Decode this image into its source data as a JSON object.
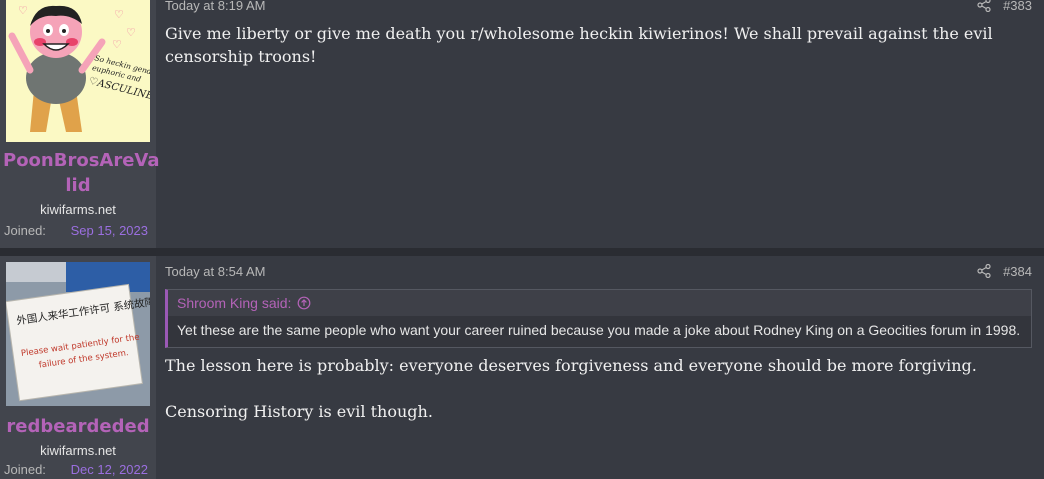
{
  "posts": [
    {
      "username": "PoonBrosAreValid",
      "username_line1": "PoonBrosAreVa",
      "username_line2": "lid",
      "user_title": "kiwifarms.net",
      "joined_label": "Joined:",
      "joined_date": "Sep 15, 2023",
      "avatar_text": "So heckin gender euphoric and MASCULINE",
      "timestamp": "Today at 8:19 AM",
      "post_number": "#383",
      "body": "Give me liberty or give me death you r/wholesome heckin kiwierinos! We shall prevail against the evil censorship troons!"
    },
    {
      "username": "redbeardeded",
      "user_title": "kiwifarms.net",
      "joined_label": "Joined:",
      "joined_date": "Dec 12, 2022",
      "avatar_text_cn": "外国人来华工作许可 系统故障,请耐心等待",
      "avatar_text_en": "Please wait patiently for the failure of the system.",
      "timestamp": "Today at 8:54 AM",
      "post_number": "#384",
      "quote_author": "Shroom King said:",
      "quote_body": "Yet these are the same people who want your career ruined because you made a joke about Rodney King on a Geocities forum in 1998.",
      "body_p1": "The lesson here is probably: everyone deserves forgiveness and everyone should be more forgiving.",
      "body_p2": "Censoring History is evil though."
    }
  ],
  "icons": {
    "share": "share-icon",
    "quote_jump": "arrow-up-circle-icon"
  },
  "colors": {
    "username": "#b463b8",
    "joined_date": "#9b6fe0",
    "quote_border": "#9b59b6"
  }
}
